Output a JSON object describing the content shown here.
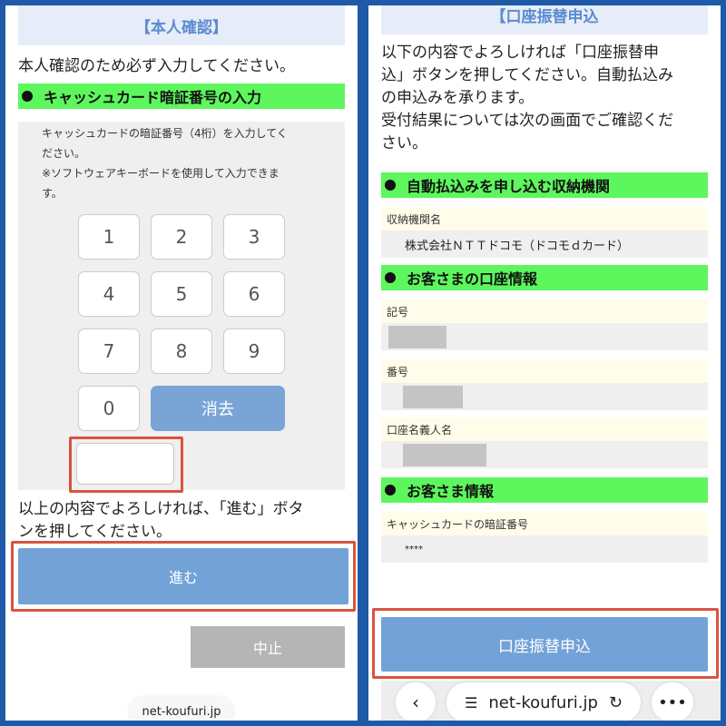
{
  "left": {
    "title": "【本人確認】",
    "intro": "本人確認のため必ず入力してください。",
    "section_heading": "キャッシュカード暗証番号の入力",
    "note_line1": "キャッシュカードの暗証番号（4桁）を入力してく",
    "note_line2": "ださい。",
    "note_line3": "※ソフトウェアキーボードを使用して入力できま",
    "note_line4": "す。",
    "keys": [
      "1",
      "2",
      "3",
      "4",
      "5",
      "6",
      "7",
      "8",
      "9",
      "0"
    ],
    "clear_label": "消去",
    "pin_value": "",
    "confirm_line1": "以上の内容でよろしければ、「進む」ボタ",
    "confirm_line2": "ンを押してください。",
    "next_label": "進む",
    "cancel_label": "中止",
    "url": "net-koufuri.jp"
  },
  "right": {
    "title": "【口座振替申込",
    "desc_line1": "以下の内容でよろしければ「口座振替申",
    "desc_line2": "込」ボタンを押してください。自動払込み",
    "desc_line3": "の申込みを承ります。",
    "desc_line4": "受付結果については次の画面でご確認くだ",
    "desc_line5": "さい。",
    "section1": "自動払込みを申し込む収納機関",
    "institution_label": "収納機関名",
    "institution_value": "株式会社ＮＴＴドコモ（ドコモｄカード）",
    "section2": "お客さまの口座情報",
    "symbol_label": "記号",
    "number_label": "番号",
    "holder_label": "口座名義人名",
    "section3": "お客さま情報",
    "pin_label": "キャッシュカードの暗証番号",
    "pin_value": "****",
    "submit_label": "口座振替申込",
    "url": "net-koufuri.jp"
  }
}
